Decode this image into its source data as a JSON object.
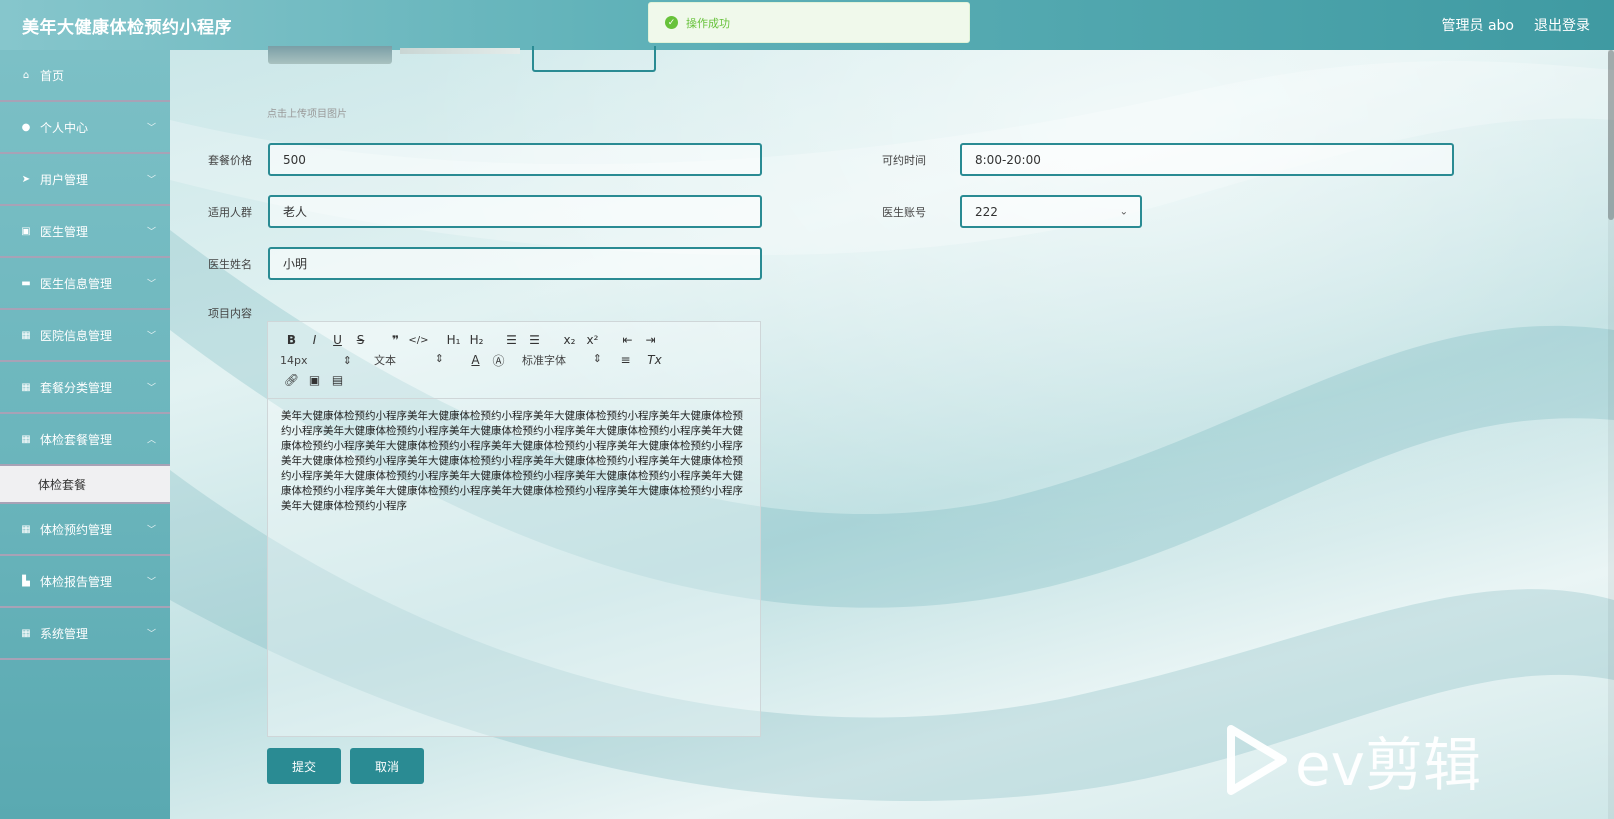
{
  "header": {
    "title": "美年大健康体检预约小程序",
    "admin": "管理员 abo",
    "logout": "退出登录"
  },
  "toast": {
    "message": "操作成功"
  },
  "sidebar": {
    "items": [
      {
        "label": "首页",
        "icon": "home-icon"
      },
      {
        "label": "个人中心",
        "icon": "user-icon"
      },
      {
        "label": "用户管理",
        "icon": "send-icon"
      },
      {
        "label": "医生管理",
        "icon": "chart-icon"
      },
      {
        "label": "医生信息管理",
        "icon": "message-icon"
      },
      {
        "label": "医院信息管理",
        "icon": "grid-icon"
      },
      {
        "label": "套餐分类管理",
        "icon": "grid-icon"
      },
      {
        "label": "体检套餐管理",
        "icon": "grid-icon"
      },
      {
        "label": "体检预约管理",
        "icon": "grid-icon"
      },
      {
        "label": "体检报告管理",
        "icon": "chart-icon"
      },
      {
        "label": "系统管理",
        "icon": "grid-icon"
      }
    ],
    "active_sub": "体检套餐"
  },
  "form": {
    "upload_hint": "点击上传项目图片",
    "price_label": "套餐价格",
    "price_value": "500",
    "time_label": "可约时间",
    "time_value": "8:00-20:00",
    "crowd_label": "适用人群",
    "crowd_value": "老人",
    "doctor_account_label": "医生账号",
    "doctor_account_value": "222",
    "doctor_name_label": "医生姓名",
    "doctor_name_value": "小明",
    "content_label": "项目内容",
    "content_text": "美年大健康体检预约小程序美年大健康体检预约小程序美年大健康体检预约小程序美年大健康体检预约小程序美年大健康体检预约小程序美年大健康体检预约小程序美年大健康体检预约小程序美年大健康体检预约小程序美年大健康体检预约小程序美年大健康体检预约小程序美年大健康体检预约小程序美年大健康体检预约小程序美年大健康体检预约小程序美年大健康体检预约小程序美年大健康体检预约小程序美年大健康体检预约小程序美年大健康体检预约小程序美年大健康体检预约小程序美年大健康体检预约小程序美年大健康体检预约小程序美年大健康体检预约小程序美年大健康体检预约小程序美年大健康体检预约小程序",
    "submit": "提交",
    "cancel": "取消"
  },
  "editor": {
    "font_size": "14px",
    "text_type": "文本",
    "font_family": "标准字体"
  },
  "watermark": "ev剪辑"
}
